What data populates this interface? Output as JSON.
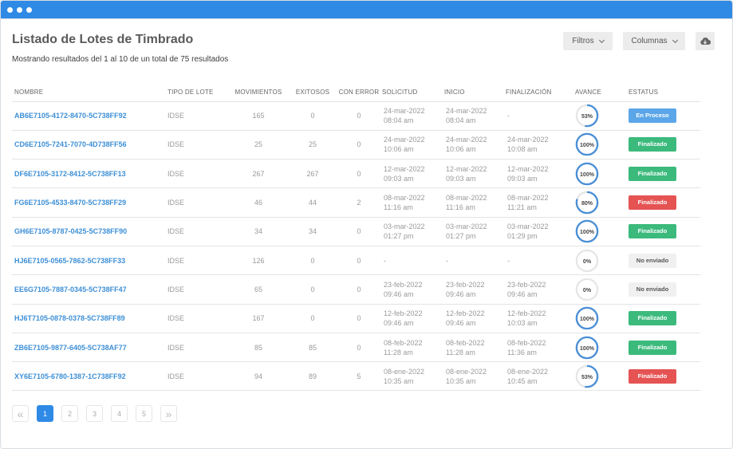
{
  "window": {
    "controls": [
      "dot",
      "dot",
      "dot"
    ]
  },
  "header": {
    "title": "Listado de Lotes de Timbrado",
    "summary": "Mostrando resultados del 1 al 10 de un total de 75 resultados"
  },
  "toolbar": {
    "filters_label": "Filtros",
    "columns_label": "Columnas",
    "download_icon": "cloud-download-icon"
  },
  "table": {
    "headers": [
      "NOMBRE",
      "TIPO DE LOTE",
      "MOVIMIENTOS",
      "EXITOSOS",
      "CON ERROR",
      "SOLICITUD",
      "INICIO",
      "FINALIZACIÓN",
      "AVANCE",
      "ESTATUS"
    ],
    "rows": [
      {
        "name": "AB6E7105-4172-8470-5C738FF92",
        "type": "IDSE",
        "movements": "165",
        "success": "0",
        "errors": "0",
        "request": [
          "24-mar-2022",
          "08:04 am"
        ],
        "start": [
          "24-mar-2022",
          "08:04 am"
        ],
        "end": [
          "-",
          ""
        ],
        "progress": "53%",
        "progress_value": 53,
        "status": "En Proceso",
        "status_color": "#5aa6e8"
      },
      {
        "name": "CD6E7105-7241-7070-4D738FF56",
        "type": "IDSE",
        "movements": "25",
        "success": "25",
        "errors": "0",
        "request": [
          "24-mar-2022",
          "10:06 am"
        ],
        "start": [
          "24-mar-2022",
          "10:06 am"
        ],
        "end": [
          "24-mar-2022",
          "10:08 am"
        ],
        "progress": "100%",
        "progress_value": 100,
        "status": "Finalizado",
        "status_color": "#3bba7c"
      },
      {
        "name": "DF6E7105-3172-8412-5C738FF13",
        "type": "IDSE",
        "movements": "267",
        "success": "267",
        "errors": "0",
        "request": [
          "12-mar-2022",
          "09:03 am"
        ],
        "start": [
          "12-mar-2022",
          "09:03 am"
        ],
        "end": [
          "12-mar-2022",
          "09:03 am"
        ],
        "progress": "100%",
        "progress_value": 100,
        "status": "Finalizado",
        "status_color": "#3bba7c"
      },
      {
        "name": "FG6E7105-4533-8470-5C738FF29",
        "type": "IDSE",
        "movements": "46",
        "success": "44",
        "errors": "2",
        "request": [
          "08-mar-2022",
          "11:16 am"
        ],
        "start": [
          "08-mar-2022",
          "11:16 am"
        ],
        "end": [
          "08-mar-2022",
          "11:21 am"
        ],
        "progress": "80%",
        "progress_value": 80,
        "status": "Finalizado",
        "status_color": "#e55353"
      },
      {
        "name": "GH6E7105-8787-0425-5C738FF90",
        "type": "IDSE",
        "movements": "34",
        "success": "34",
        "errors": "0",
        "request": [
          "03-mar-2022",
          "01:27 pm"
        ],
        "start": [
          "03-mar-2022",
          "01:27 pm"
        ],
        "end": [
          "03-mar-2022",
          "01:29 pm"
        ],
        "progress": "100%",
        "progress_value": 100,
        "status": "Finalizado",
        "status_color": "#3bba7c"
      },
      {
        "name": "HJ6E7105-0565-7862-5C738FF33",
        "type": "IDSE",
        "movements": "126",
        "success": "0",
        "errors": "0",
        "request": [
          "-",
          ""
        ],
        "start": [
          "-",
          ""
        ],
        "end": [
          "-",
          ""
        ],
        "progress": "0%",
        "progress_value": 0,
        "status": "No enviado",
        "status_color": "#f0f0f0"
      },
      {
        "name": "EE6G7105-7887-0345-5C738FF47",
        "type": "IDSE",
        "movements": "65",
        "success": "0",
        "errors": "0",
        "request": [
          "23-feb-2022",
          "09:46 am"
        ],
        "start": [
          "23-feb-2022",
          "09:46 am"
        ],
        "end": [
          "23-feb-2022",
          "09:46 am"
        ],
        "progress": "0%",
        "progress_value": 0,
        "status": "No enviado",
        "status_color": "#f0f0f0"
      },
      {
        "name": "HJ6T7105-0878-0378-5C738FF89",
        "type": "IDSE",
        "movements": "167",
        "success": "0",
        "errors": "0",
        "request": [
          "12-feb-2022",
          "09:46 am"
        ],
        "start": [
          "12-feb-2022",
          "09:46 am"
        ],
        "end": [
          "12-feb-2022",
          "10:03 am"
        ],
        "progress": "100%",
        "progress_value": 100,
        "status": "Finalizado",
        "status_color": "#3bba7c"
      },
      {
        "name": "ZB6E7105-9877-6405-5C738AF77",
        "type": "IDSE",
        "movements": "85",
        "success": "85",
        "errors": "0",
        "request": [
          "08-feb-2022",
          "11:28 am"
        ],
        "start": [
          "08-feb-2022",
          "11:28 am"
        ],
        "end": [
          "08-feb-2022",
          "11:36 am"
        ],
        "progress": "100%",
        "progress_value": 100,
        "status": "Finalizado",
        "status_color": "#3bba7c"
      },
      {
        "name": "XY6E7105-6780-1387-1C738FF92",
        "type": "IDSE",
        "movements": "94",
        "success": "89",
        "errors": "5",
        "request": [
          "08-ene-2022",
          "10:35 am"
        ],
        "start": [
          "08-ene-2022",
          "10:35 am"
        ],
        "end": [
          "08-ene-2022",
          "10:45 am"
        ],
        "progress": "53%",
        "progress_value": 53,
        "status": "Finalizado",
        "status_color": "#e55353"
      }
    ]
  },
  "pagination": {
    "prev": "«",
    "next": "»",
    "pages": [
      "1",
      "2",
      "3",
      "4",
      "5"
    ],
    "active": "1"
  }
}
